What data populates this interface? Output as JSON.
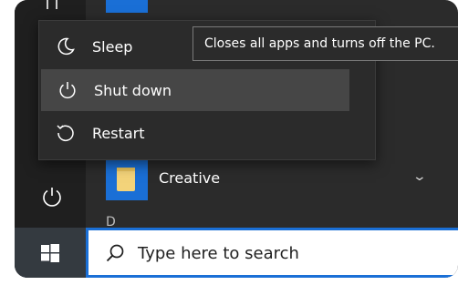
{
  "power_menu": {
    "items": [
      {
        "label": "Sleep",
        "icon": "moon-icon"
      },
      {
        "label": "Shut down",
        "icon": "power-icon"
      },
      {
        "label": "Restart",
        "icon": "restart-icon"
      }
    ]
  },
  "tooltip": {
    "text": "Closes all apps and turns off the PC."
  },
  "app_list": {
    "items": [
      {
        "label": "Creative",
        "icon": "folder-icon"
      }
    ],
    "next_section_letter": "D"
  },
  "taskbar": {
    "search_placeholder": "Type here to search",
    "start_icon": "windows-logo-icon"
  },
  "colors": {
    "accent": "#1a6fd6",
    "menu_bg": "#2b2b2b",
    "hover": "#464646"
  }
}
